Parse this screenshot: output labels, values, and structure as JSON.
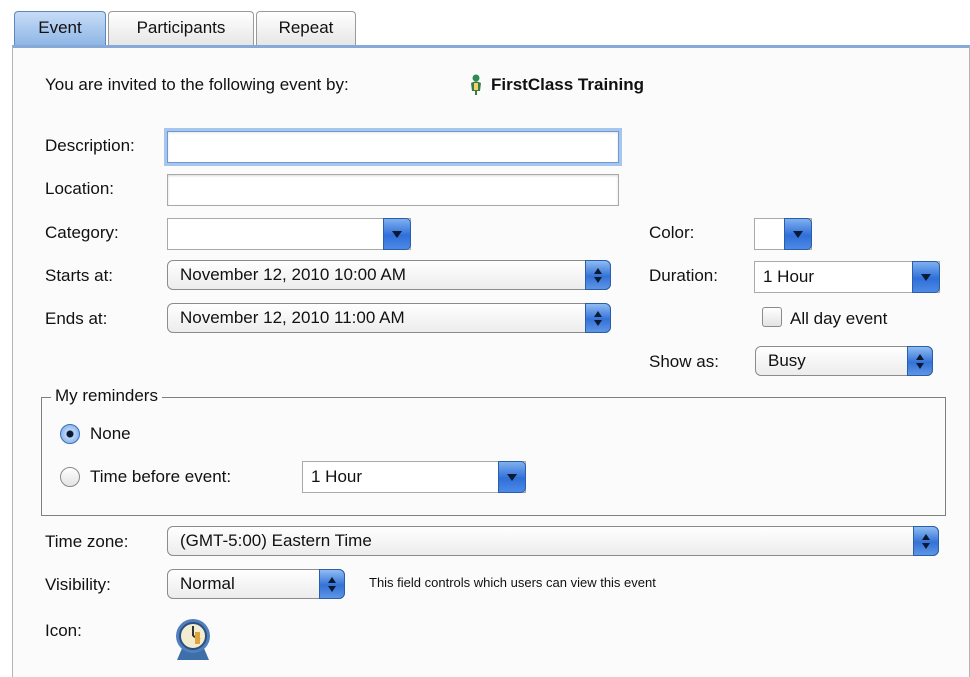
{
  "tabs": [
    "Event",
    "Participants",
    "Repeat"
  ],
  "invite": {
    "text": "You are invited to the following event by:",
    "organizer": "FirstClass Training"
  },
  "labels": {
    "description": "Description:",
    "location": "Location:",
    "category": "Category:",
    "starts_at": "Starts at:",
    "ends_at": "Ends at:",
    "color": "Color:",
    "duration": "Duration:",
    "all_day": "All day event",
    "show_as": "Show as:",
    "reminders": "My reminders",
    "none": "None",
    "time_before": "Time before event:",
    "time_zone": "Time zone:",
    "visibility": "Visibility:",
    "visibility_note": "This field controls which users can view this event",
    "icon": "Icon:"
  },
  "values": {
    "description": "",
    "location": "",
    "category": "",
    "starts_at": "November 12, 2010 10:00 AM",
    "ends_at": "November 12, 2010 11:00 AM",
    "duration": "1 Hour",
    "show_as": "Busy",
    "reminder_time": "1 Hour",
    "time_zone": "(GMT-5:00) Eastern Time",
    "visibility": "Normal",
    "all_day_checked": false,
    "reminder_selected": "None"
  },
  "icons": {
    "organizer": "user-icon",
    "event_icon": "clock-icon"
  }
}
